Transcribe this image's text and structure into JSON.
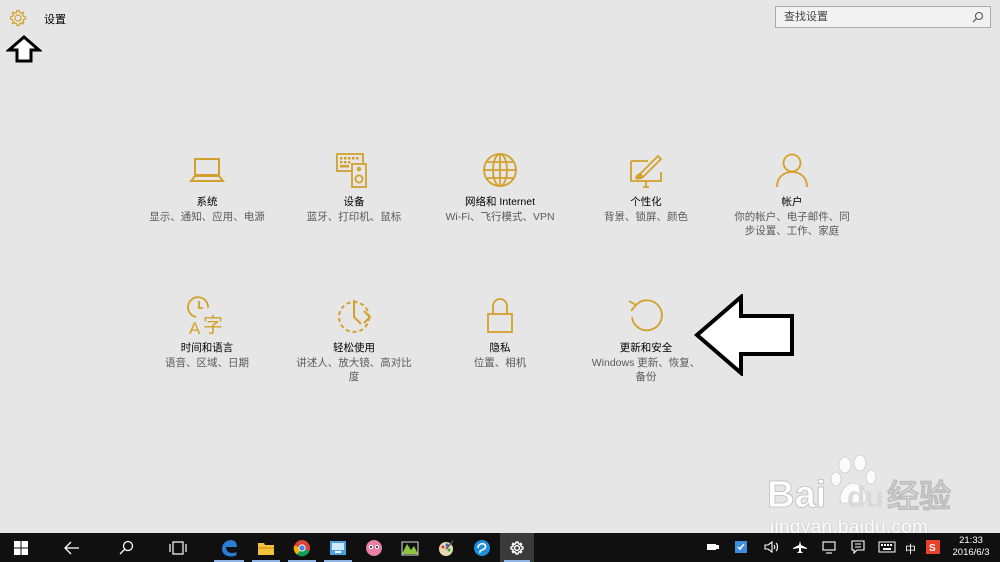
{
  "window": {
    "title": "设置"
  },
  "search": {
    "placeholder": "查找设置"
  },
  "accent_color": "#d3a12b",
  "tiles": [
    {
      "icon": "laptop-icon",
      "title": "系统",
      "desc": "显示、通知、应用、电源"
    },
    {
      "icon": "keyboard-speaker-icon",
      "title": "设备",
      "desc": "蓝牙、打印机、鼠标"
    },
    {
      "icon": "globe-icon",
      "title": "网络和 Internet",
      "desc": "Wi-Fi、飞行模式、VPN"
    },
    {
      "icon": "personalization-icon",
      "title": "个性化",
      "desc": "背景、锁屏、颜色"
    },
    {
      "icon": "person-icon",
      "title": "帐户",
      "desc": "你的帐户、电子邮件、同步设置、工作、家庭"
    },
    {
      "icon": "time-language-icon",
      "title": "时间和语言",
      "desc": "语音、区域、日期"
    },
    {
      "icon": "ease-of-access-icon",
      "title": "轻松使用",
      "desc": "讲述人、放大镜、高对比度"
    },
    {
      "icon": "lock-icon",
      "title": "隐私",
      "desc": "位置、相机"
    },
    {
      "icon": "update-icon",
      "title": "更新和安全",
      "desc": "Windows 更新、恢复、备份"
    }
  ],
  "watermark": {
    "brand": "Bai",
    "brand2": "du",
    "product": "经验",
    "url": "jingyan.baidu.com"
  },
  "taskbar": {
    "items": [
      "start-icon",
      "back-icon",
      "search-icon",
      "task-view-icon",
      "edge-icon",
      "file-explorer-icon",
      "chrome-icon",
      "app-icon",
      "app-icon",
      "app-icon",
      "app-icon",
      "app-icon",
      "settings-icon"
    ],
    "ime": "中",
    "time": "21:33",
    "date": "2016/6/3"
  }
}
